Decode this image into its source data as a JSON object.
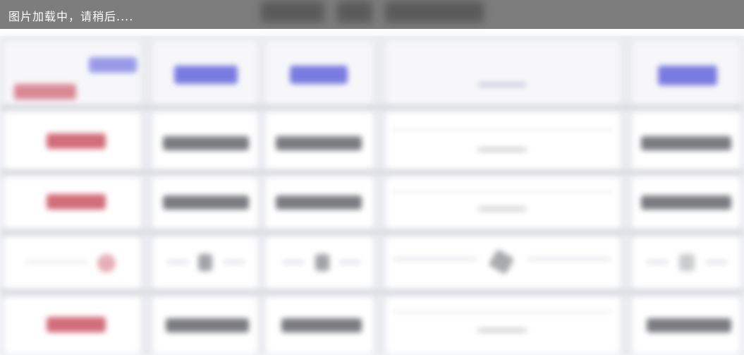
{
  "loading": {
    "text": "图片加载中，请稍后...."
  },
  "colors": {
    "header_bar": "#7d7d7d",
    "accent_blue": "#7a7be0",
    "accent_red": "#d26d7a",
    "grid_bg": "#eaebef"
  },
  "table": {
    "columns": [
      "col-1",
      "col-2",
      "col-3",
      "col-4",
      "col-5"
    ],
    "rows": [
      "row-1",
      "row-2",
      "row-3",
      "row-4"
    ]
  }
}
